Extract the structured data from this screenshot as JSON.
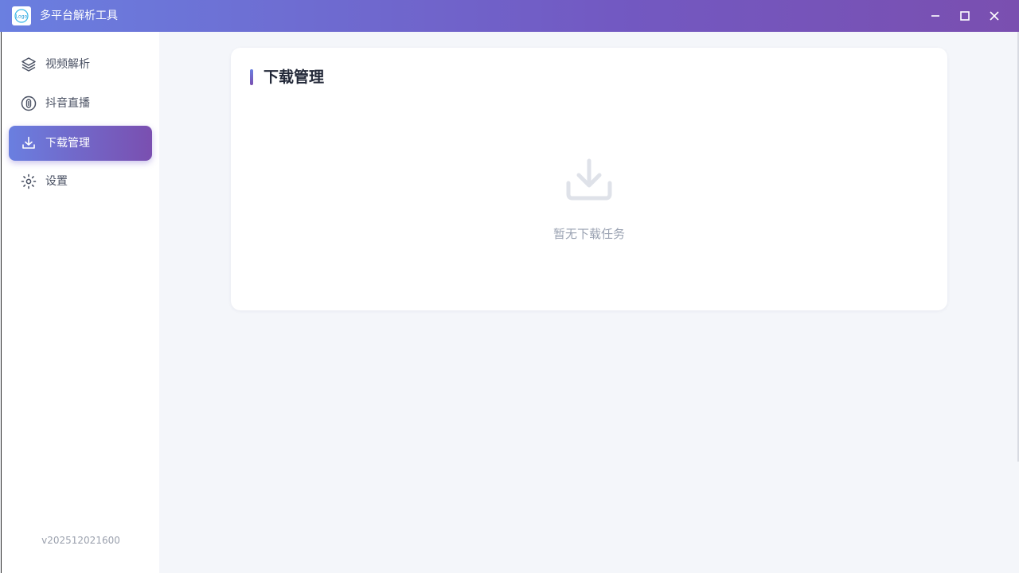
{
  "window": {
    "title": "多平台解析工具",
    "logo_text": "Logo",
    "controls": {
      "minimize_icon": "minimize-icon",
      "maximize_icon": "maximize-icon",
      "close_icon": "close-icon"
    }
  },
  "sidebar": {
    "items": [
      {
        "label": "视频解析",
        "icon": "layers-icon",
        "active": false
      },
      {
        "label": "抖音直播",
        "icon": "live-icon",
        "active": false
      },
      {
        "label": "下载管理",
        "icon": "download-icon",
        "active": true
      },
      {
        "label": "设置",
        "icon": "settings-icon",
        "active": false
      }
    ],
    "version": "v202512021600"
  },
  "main": {
    "title": "下载管理",
    "empty_state": {
      "icon": "download-tray-icon",
      "text": "暂无下载任务"
    }
  },
  "colors": {
    "accent_start": "#6a7fe0",
    "accent_end": "#7a4fb0",
    "background": "#f4f6fa",
    "text_muted": "#9aa2b2"
  }
}
